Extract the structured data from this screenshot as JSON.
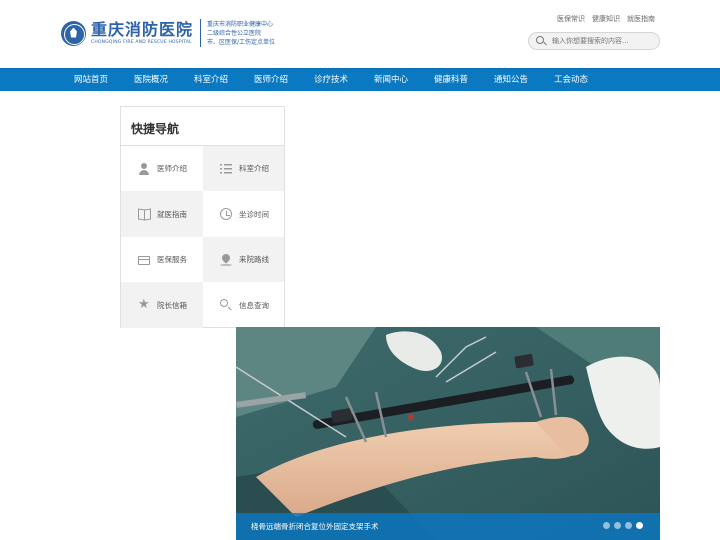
{
  "brand": {
    "name_cn": "重庆消防医院",
    "name_en": "CHONGQING FIRE AND RESCUE HOSPITAL",
    "tags": [
      "重庆市消防职业健康中心",
      "二级综合性公立医院",
      "市、区医保/工伤定点单位"
    ],
    "color": "#2d63a8"
  },
  "top_links": [
    "医保常识",
    "健康知识",
    "就医指南"
  ],
  "search": {
    "placeholder": "输入你想要搜索的内容..."
  },
  "nav": {
    "color": "#0b78c2",
    "items": [
      "网站首页",
      "医院概况",
      "科室介绍",
      "医师介绍",
      "诊疗技术",
      "新闻中心",
      "健康科普",
      "通知公告",
      "工会动态"
    ]
  },
  "quick_nav": {
    "title": "快捷导航",
    "items": [
      {
        "label": "医师介绍",
        "icon": "doctor-icon"
      },
      {
        "label": "科室介绍",
        "icon": "list-icon"
      },
      {
        "label": "就医指南",
        "icon": "book-icon"
      },
      {
        "label": "坐诊时间",
        "icon": "clock-icon"
      },
      {
        "label": "医保服务",
        "icon": "card-icon"
      },
      {
        "label": "来院路线",
        "icon": "location-pin-icon"
      },
      {
        "label": "院长信箱",
        "icon": "star-icon"
      },
      {
        "label": "信息查询",
        "icon": "search-icon"
      }
    ]
  },
  "banner": {
    "caption": "桡骨远端骨折闭合复位外固定支架手术",
    "slide_count": 4,
    "active_slide": 4
  }
}
